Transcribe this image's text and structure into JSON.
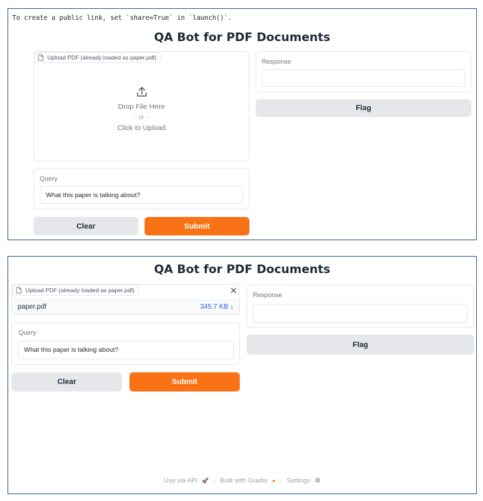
{
  "share_notice": "To create a public link, set `share=True` in `launch()`.",
  "app_title": "QA Bot for PDF Documents",
  "upload": {
    "label": "Upload PDF (already loaded as paper.pdf)",
    "drop_text": "Drop File Here",
    "or_text": "- or -",
    "click_text": "Click to Upload",
    "file_name": "paper.pdf",
    "file_size": "345.7 KB",
    "download_glyph": "↓",
    "close_glyph": "✕"
  },
  "query": {
    "label": "Query",
    "value": "What this paper is talking about?"
  },
  "response": {
    "label": "Response",
    "value": ""
  },
  "buttons": {
    "clear": "Clear",
    "submit": "Submit",
    "flag": "Flag"
  },
  "footer": {
    "api": "Use via API",
    "api_glyph": "🚀",
    "sep": "·",
    "built": "Built with Gradio",
    "built_glyph": "●",
    "settings": "Settings",
    "settings_glyph": "⚙"
  },
  "colors": {
    "primary": "#f97316",
    "secondary": "#e5e7eb",
    "panel_border": "#2e5d8e",
    "link": "#2563eb"
  },
  "icons": [
    "file-icon",
    "upload-icon",
    "close-icon",
    "download-icon",
    "rocket-icon",
    "gradio-logo-icon",
    "gear-icon"
  ]
}
